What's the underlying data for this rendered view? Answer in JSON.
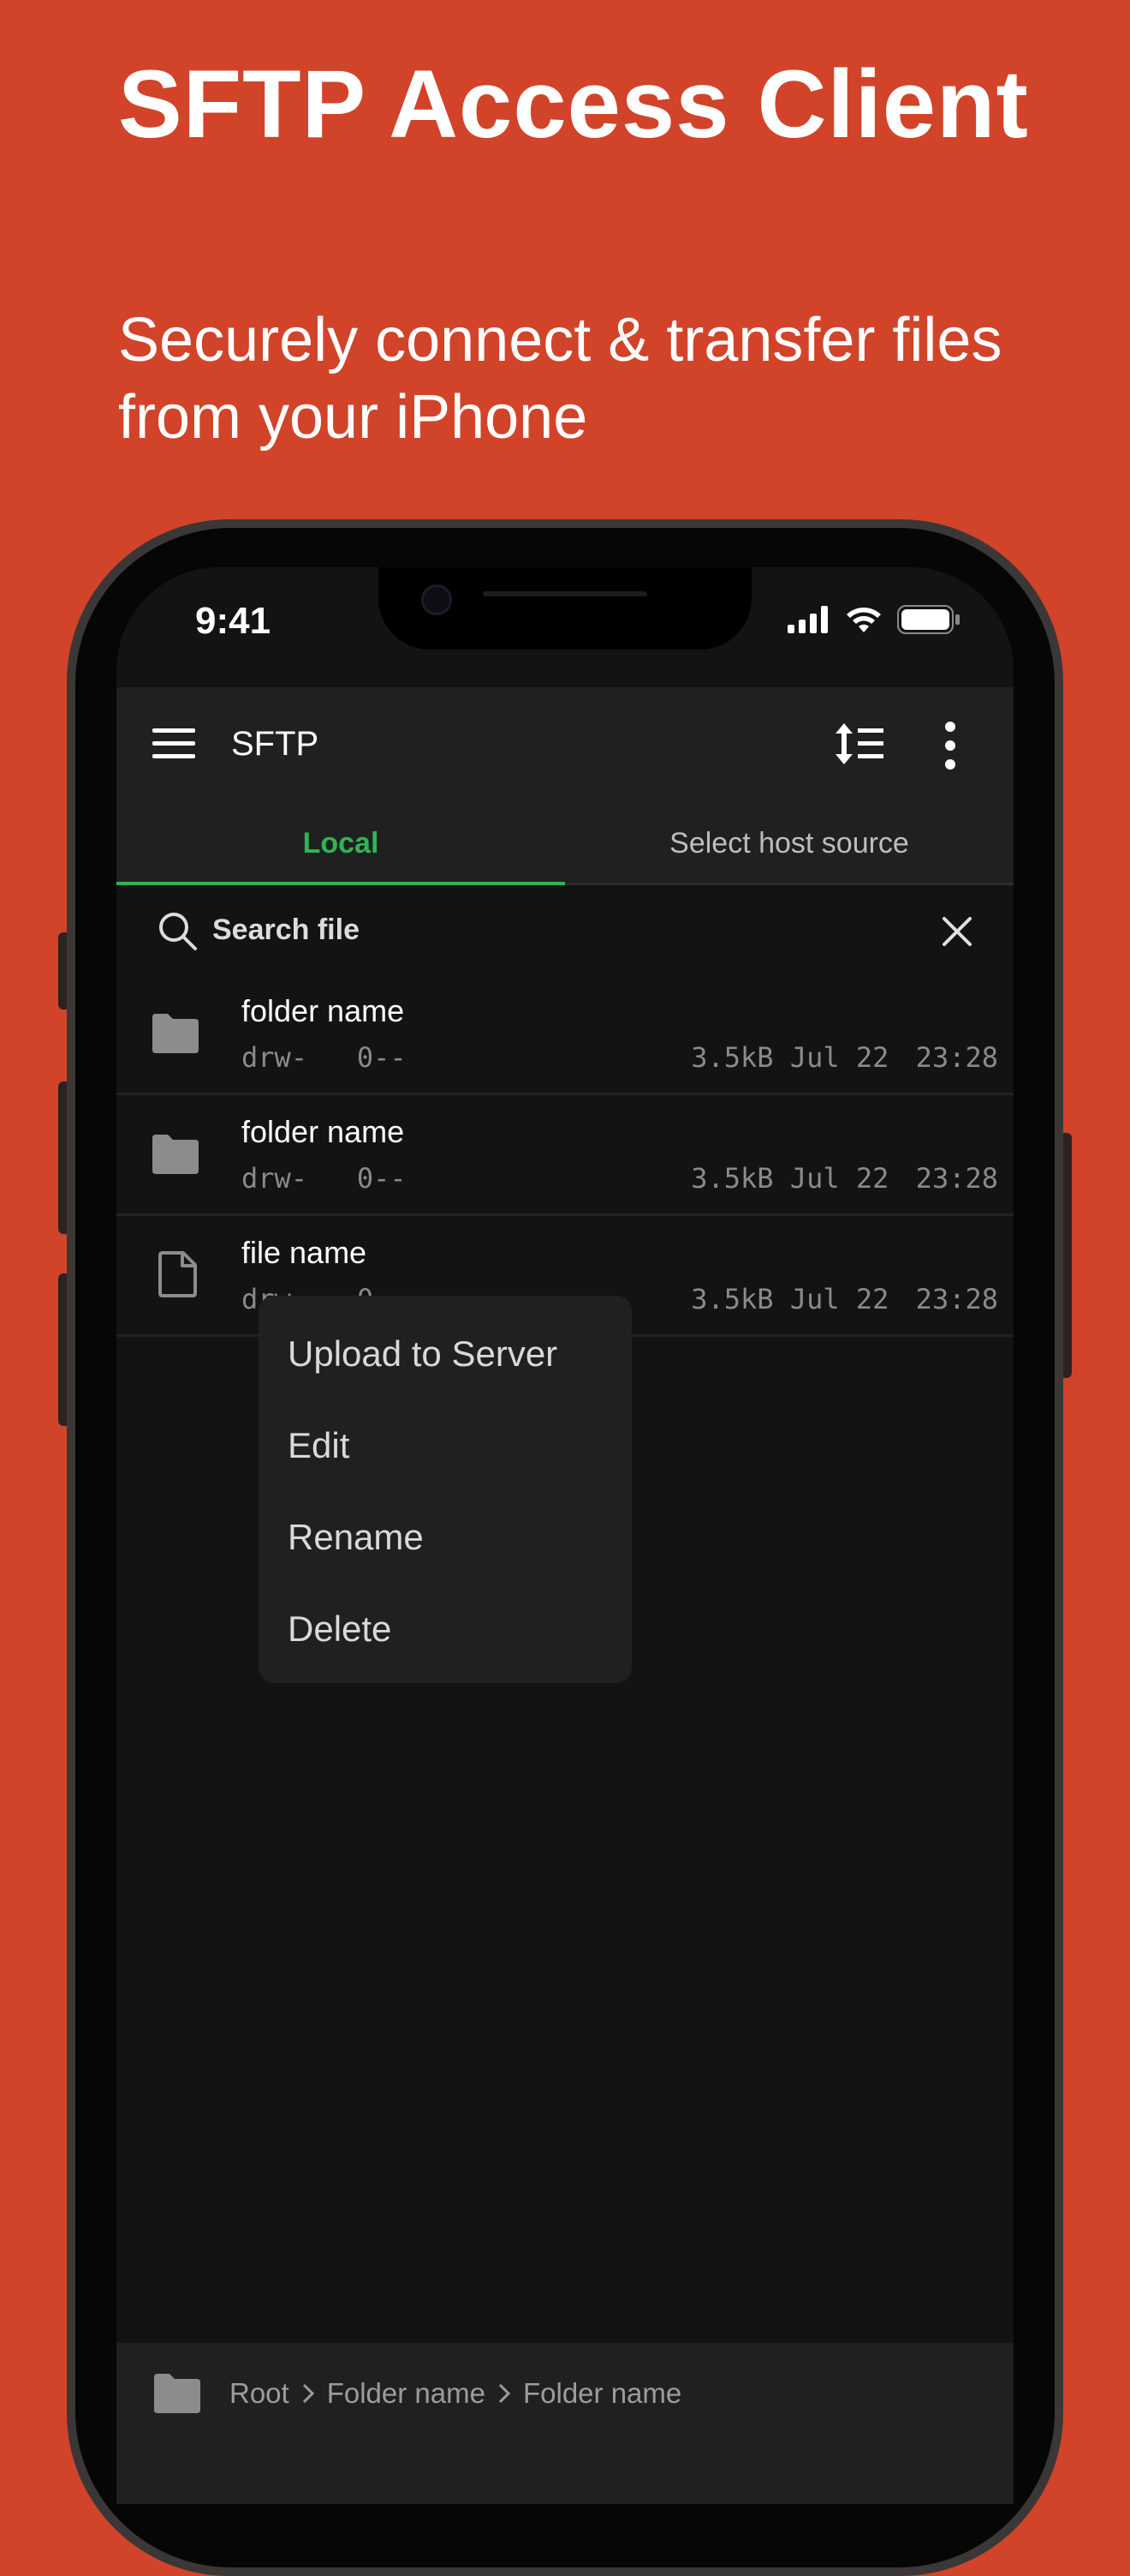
{
  "hero": {
    "title": "SFTP Access Client",
    "subtitle": "Securely connect & transfer files from your iPhone"
  },
  "status_bar": {
    "time": "9:41"
  },
  "app_bar": {
    "title": "SFTP",
    "menu_icon": "hamburger-icon",
    "sort_icon": "sort-icon",
    "more_icon": "more-vert-icon"
  },
  "tabs": [
    {
      "label": "Local",
      "active": true
    },
    {
      "label": "Select host source",
      "active": false
    }
  ],
  "search": {
    "placeholder": "Search file",
    "value": ""
  },
  "files": [
    {
      "name": "folder name",
      "type": "folder",
      "permissions": "drw-   0--",
      "size": "3.5kB",
      "date": "Jul 22",
      "time": "23:28"
    },
    {
      "name": "folder name",
      "type": "folder",
      "permissions": "drw-   0--",
      "size": "3.5kB",
      "date": "Jul 22",
      "time": "23:28"
    },
    {
      "name": "file name",
      "type": "file",
      "permissions": "drw-   0--",
      "size": "3.5kB",
      "date": "Jul 22",
      "time": "23:28"
    }
  ],
  "context_menu": {
    "items": [
      "Upload to Server",
      "Edit",
      "Rename",
      "Delete"
    ]
  },
  "breadcrumb": {
    "items": [
      "Root",
      "Folder name",
      "Folder name"
    ]
  },
  "colors": {
    "background": "#d1442a",
    "accent": "#2fb552",
    "screen": "#131313",
    "bar": "#202020"
  }
}
